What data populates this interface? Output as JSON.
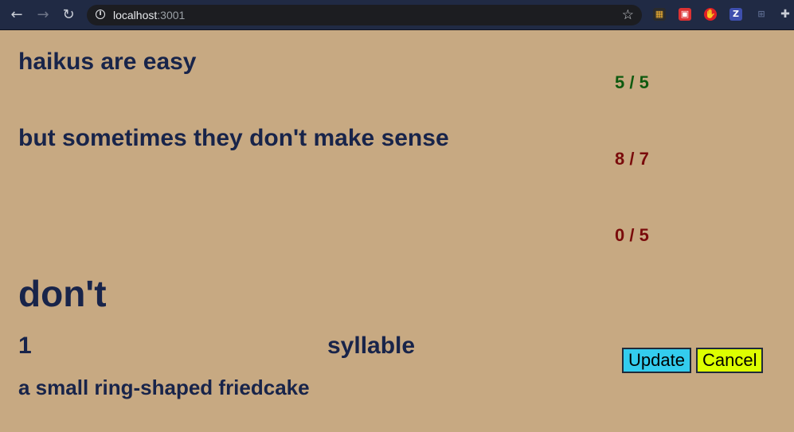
{
  "browser": {
    "back_icon": "arrow-left-icon",
    "forward_icon": "arrow-right-icon",
    "reload_icon": "reload-icon",
    "url_host": "localhost",
    "url_port": ":3001"
  },
  "haiku": {
    "lines": [
      {
        "text": "haikus are easy",
        "count": "5 / 5",
        "color": "#0f5a0f"
      },
      {
        "text": "but sometimes they don't make sense",
        "count": "8 / 7",
        "color": "#7a0b0b"
      },
      {
        "text": "",
        "count": "0 / 5",
        "color": "#7a0b0b"
      }
    ]
  },
  "word_editor": {
    "word": "don't",
    "syllables": "1",
    "syllable_label": "syllable",
    "definition": "a small ring-shaped friedcake",
    "update_label": "Update",
    "cancel_label": "Cancel",
    "update_color": "#33ccee",
    "cancel_color": "#ddff00"
  }
}
